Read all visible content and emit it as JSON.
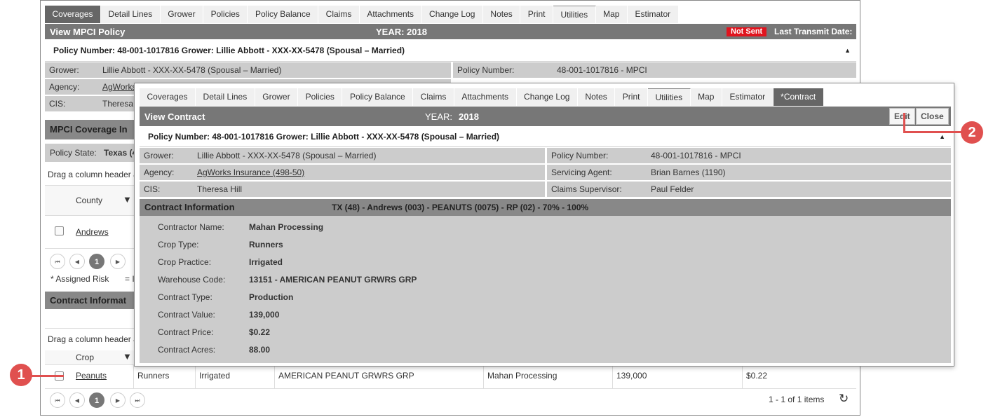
{
  "back": {
    "tabs": [
      "Coverages",
      "Detail Lines",
      "Grower",
      "Policies",
      "Policy Balance",
      "Claims",
      "Attachments",
      "Change Log",
      "Notes",
      "Print",
      "Utilities",
      "Map",
      "Estimator"
    ],
    "title": "View MPCI Policy",
    "year_label": "YEAR: 2018",
    "status_badge": "Not Sent",
    "last_transmit": "Last Transmit Date:",
    "policy_line": "Policy Number: 48-001-1017816 Grower: Lillie Abbott - XXX-XX-5478 (Spousal – Married)",
    "grower_label": "Grower:",
    "grower_value": "Lillie Abbott - XXX-XX-5478 (Spousal – Married)",
    "policy_number_label": "Policy Number:",
    "policy_number_value": "48-001-1017816 - MPCI",
    "agency_label": "Agency:",
    "agency_value": "AgWorks",
    "cis_label": "CIS:",
    "cis_value": "Theresa",
    "coverage_header": "MPCI Coverage In",
    "policy_state_label": "Policy State:",
    "policy_state_value": "Texas (4",
    "drag_hint": "Drag a column header a",
    "county_header": "County",
    "county_row": "Andrews",
    "page_current": "1",
    "assigned_risk": "* Assigned Risk",
    "assigned_risk_eq": "= I",
    "contract_header": "Contract Informat",
    "drag_hint2": "Drag a column header a",
    "crop_header": "Crop",
    "contract_row": {
      "crop": "Peanuts",
      "type": "Runners",
      "practice": "Irrigated",
      "warehouse": "AMERICAN PEANUT GRWRS GRP",
      "contractor": "Mahan Processing",
      "value": "139,000",
      "price": "$0.22"
    },
    "items_count": "1 - 1 of 1 items"
  },
  "front": {
    "tabs": [
      "Coverages",
      "Detail Lines",
      "Grower",
      "Policies",
      "Policy Balance",
      "Claims",
      "Attachments",
      "Change Log",
      "Notes",
      "Print",
      "Utilities",
      "Map",
      "Estimator",
      "*Contract"
    ],
    "title": "View Contract",
    "year_label": "YEAR:",
    "year_value": "2018",
    "edit": "Edit",
    "close": "Close",
    "policy_line": "Policy Number: 48-001-1017816 Grower: Lillie Abbott - XXX-XX-5478 (Spousal – Married)",
    "grower_label": "Grower:",
    "grower_value": "Lillie Abbott - XXX-XX-5478 (Spousal – Married)",
    "policy_number_label": "Policy Number:",
    "policy_number_value": "48-001-1017816 - MPCI",
    "agency_label": "Agency:",
    "agency_value": "AgWorks Insurance (498-50)",
    "servicing_label": "Servicing Agent:",
    "servicing_value": "Brian Barnes (1190)",
    "cis_label": "CIS:",
    "cis_value": "Theresa Hill",
    "claims_label": "Claims Supervisor:",
    "claims_value": "Paul Felder",
    "section_title": "Contract Information",
    "section_summary": "TX (48) - Andrews (003) - PEANUTS (0075) - RP (02) - 70% - 100%",
    "fields": [
      {
        "label": "Contractor Name:",
        "value": "Mahan Processing"
      },
      {
        "label": "Crop Type:",
        "value": "Runners"
      },
      {
        "label": "Crop Practice:",
        "value": "Irrigated"
      },
      {
        "label": "Warehouse Code:",
        "value": "13151 - AMERICAN PEANUT GRWRS GRP"
      },
      {
        "label": "Contract Type:",
        "value": "Production"
      },
      {
        "label": "Contract Value:",
        "value": "139,000"
      },
      {
        "label": "Contract Price:",
        "value": "$0.22"
      },
      {
        "label": "Contract Acres:",
        "value": "88.00"
      }
    ]
  },
  "callouts": [
    "1",
    "2"
  ],
  "colors": {
    "accent_red": "#e0504f",
    "badge_red": "#e0141e",
    "title_gray": "#777777"
  }
}
